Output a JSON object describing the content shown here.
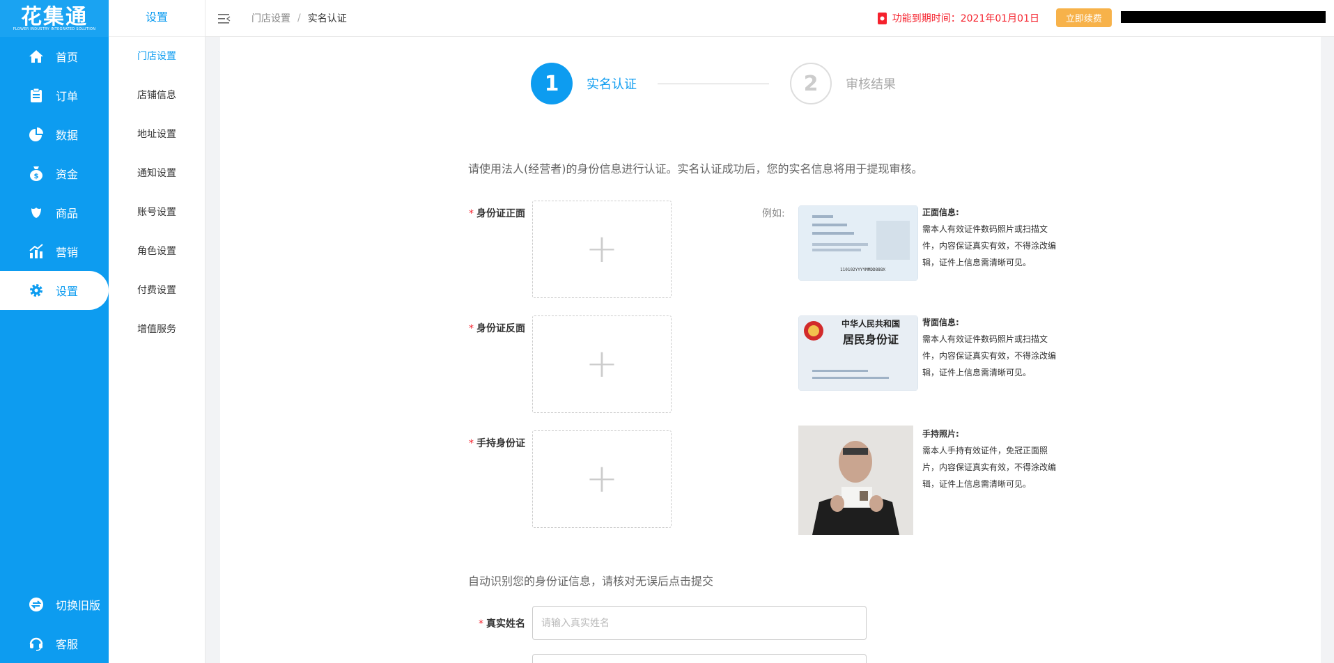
{
  "brand": {
    "logo_text": "花集通",
    "logo_sub": "FLOWER INDUSTRY INTEGRATED SOLUTION"
  },
  "nav": {
    "items": [
      {
        "label": "首页",
        "icon": "home-icon"
      },
      {
        "label": "订单",
        "icon": "clipboard-icon"
      },
      {
        "label": "数据",
        "icon": "pie-chart-icon"
      },
      {
        "label": "资金",
        "icon": "money-bag-icon"
      },
      {
        "label": "商品",
        "icon": "flower-icon"
      },
      {
        "label": "营销",
        "icon": "bar-chart-icon"
      },
      {
        "label": "设置",
        "icon": "gear-icon",
        "active": true
      }
    ],
    "bottom": [
      {
        "label": "切换旧版",
        "icon": "switch-icon"
      },
      {
        "label": "客服",
        "icon": "headset-icon"
      }
    ]
  },
  "subnav": {
    "title": "设置",
    "items": [
      "门店设置",
      "店铺信息",
      "地址设置",
      "通知设置",
      "账号设置",
      "角色设置",
      "付费设置",
      "增值服务"
    ]
  },
  "header": {
    "breadcrumb": {
      "parent": "门店设置",
      "separator": "/",
      "current": "实名认证"
    },
    "expire_text": "功能到期时间：2021年01月01日",
    "renew_label": "立即续费"
  },
  "steps": [
    {
      "num": "1",
      "label": "实名认证",
      "active": true
    },
    {
      "num": "2",
      "label": "审核结果",
      "active": false
    }
  ],
  "intro": "请使用法人(经营者)的身份信息进行认证。实名认证成功后，您的实名信息将用于提现审核。",
  "uploads": [
    {
      "label": "身份证正面",
      "required": "*"
    },
    {
      "label": "身份证反面",
      "required": "*"
    },
    {
      "label": "手持身份证",
      "required": "*"
    }
  ],
  "example_label": "例如:",
  "examples": [
    {
      "title": "正面信息:",
      "lines": [
        "需本人有效证件数码照片或扫描文",
        "件，内容保证真实有效，不得涂改编",
        "辑，证件上信息需清晰可见。"
      ]
    },
    {
      "title": "背面信息:",
      "lines": [
        "需本人有效证件数码照片或扫描文",
        "件，内容保证真实有效，不得涂改编",
        "辑，证件上信息需清晰可见。"
      ],
      "card_line1": "中华人民共和国",
      "card_line2": "居民身份证"
    },
    {
      "title": "手持照片:",
      "lines": [
        "需本人手持有效证件，免冠正面照",
        "片，内容保证真实有效，不得涂改编",
        "辑，证件上信息需清晰可见。"
      ]
    }
  ],
  "auto_note": "自动识别您的身份证信息，请核对无误后点击提交",
  "name_field": {
    "label": "真实姓名",
    "required": "*",
    "placeholder": "请输入真实姓名",
    "value": ""
  },
  "front_card_number": "110102YYYYMMDD888X",
  "colors": {
    "primary": "#0d9cf0",
    "danger": "#f5222d",
    "renew": "#f7b24a"
  }
}
